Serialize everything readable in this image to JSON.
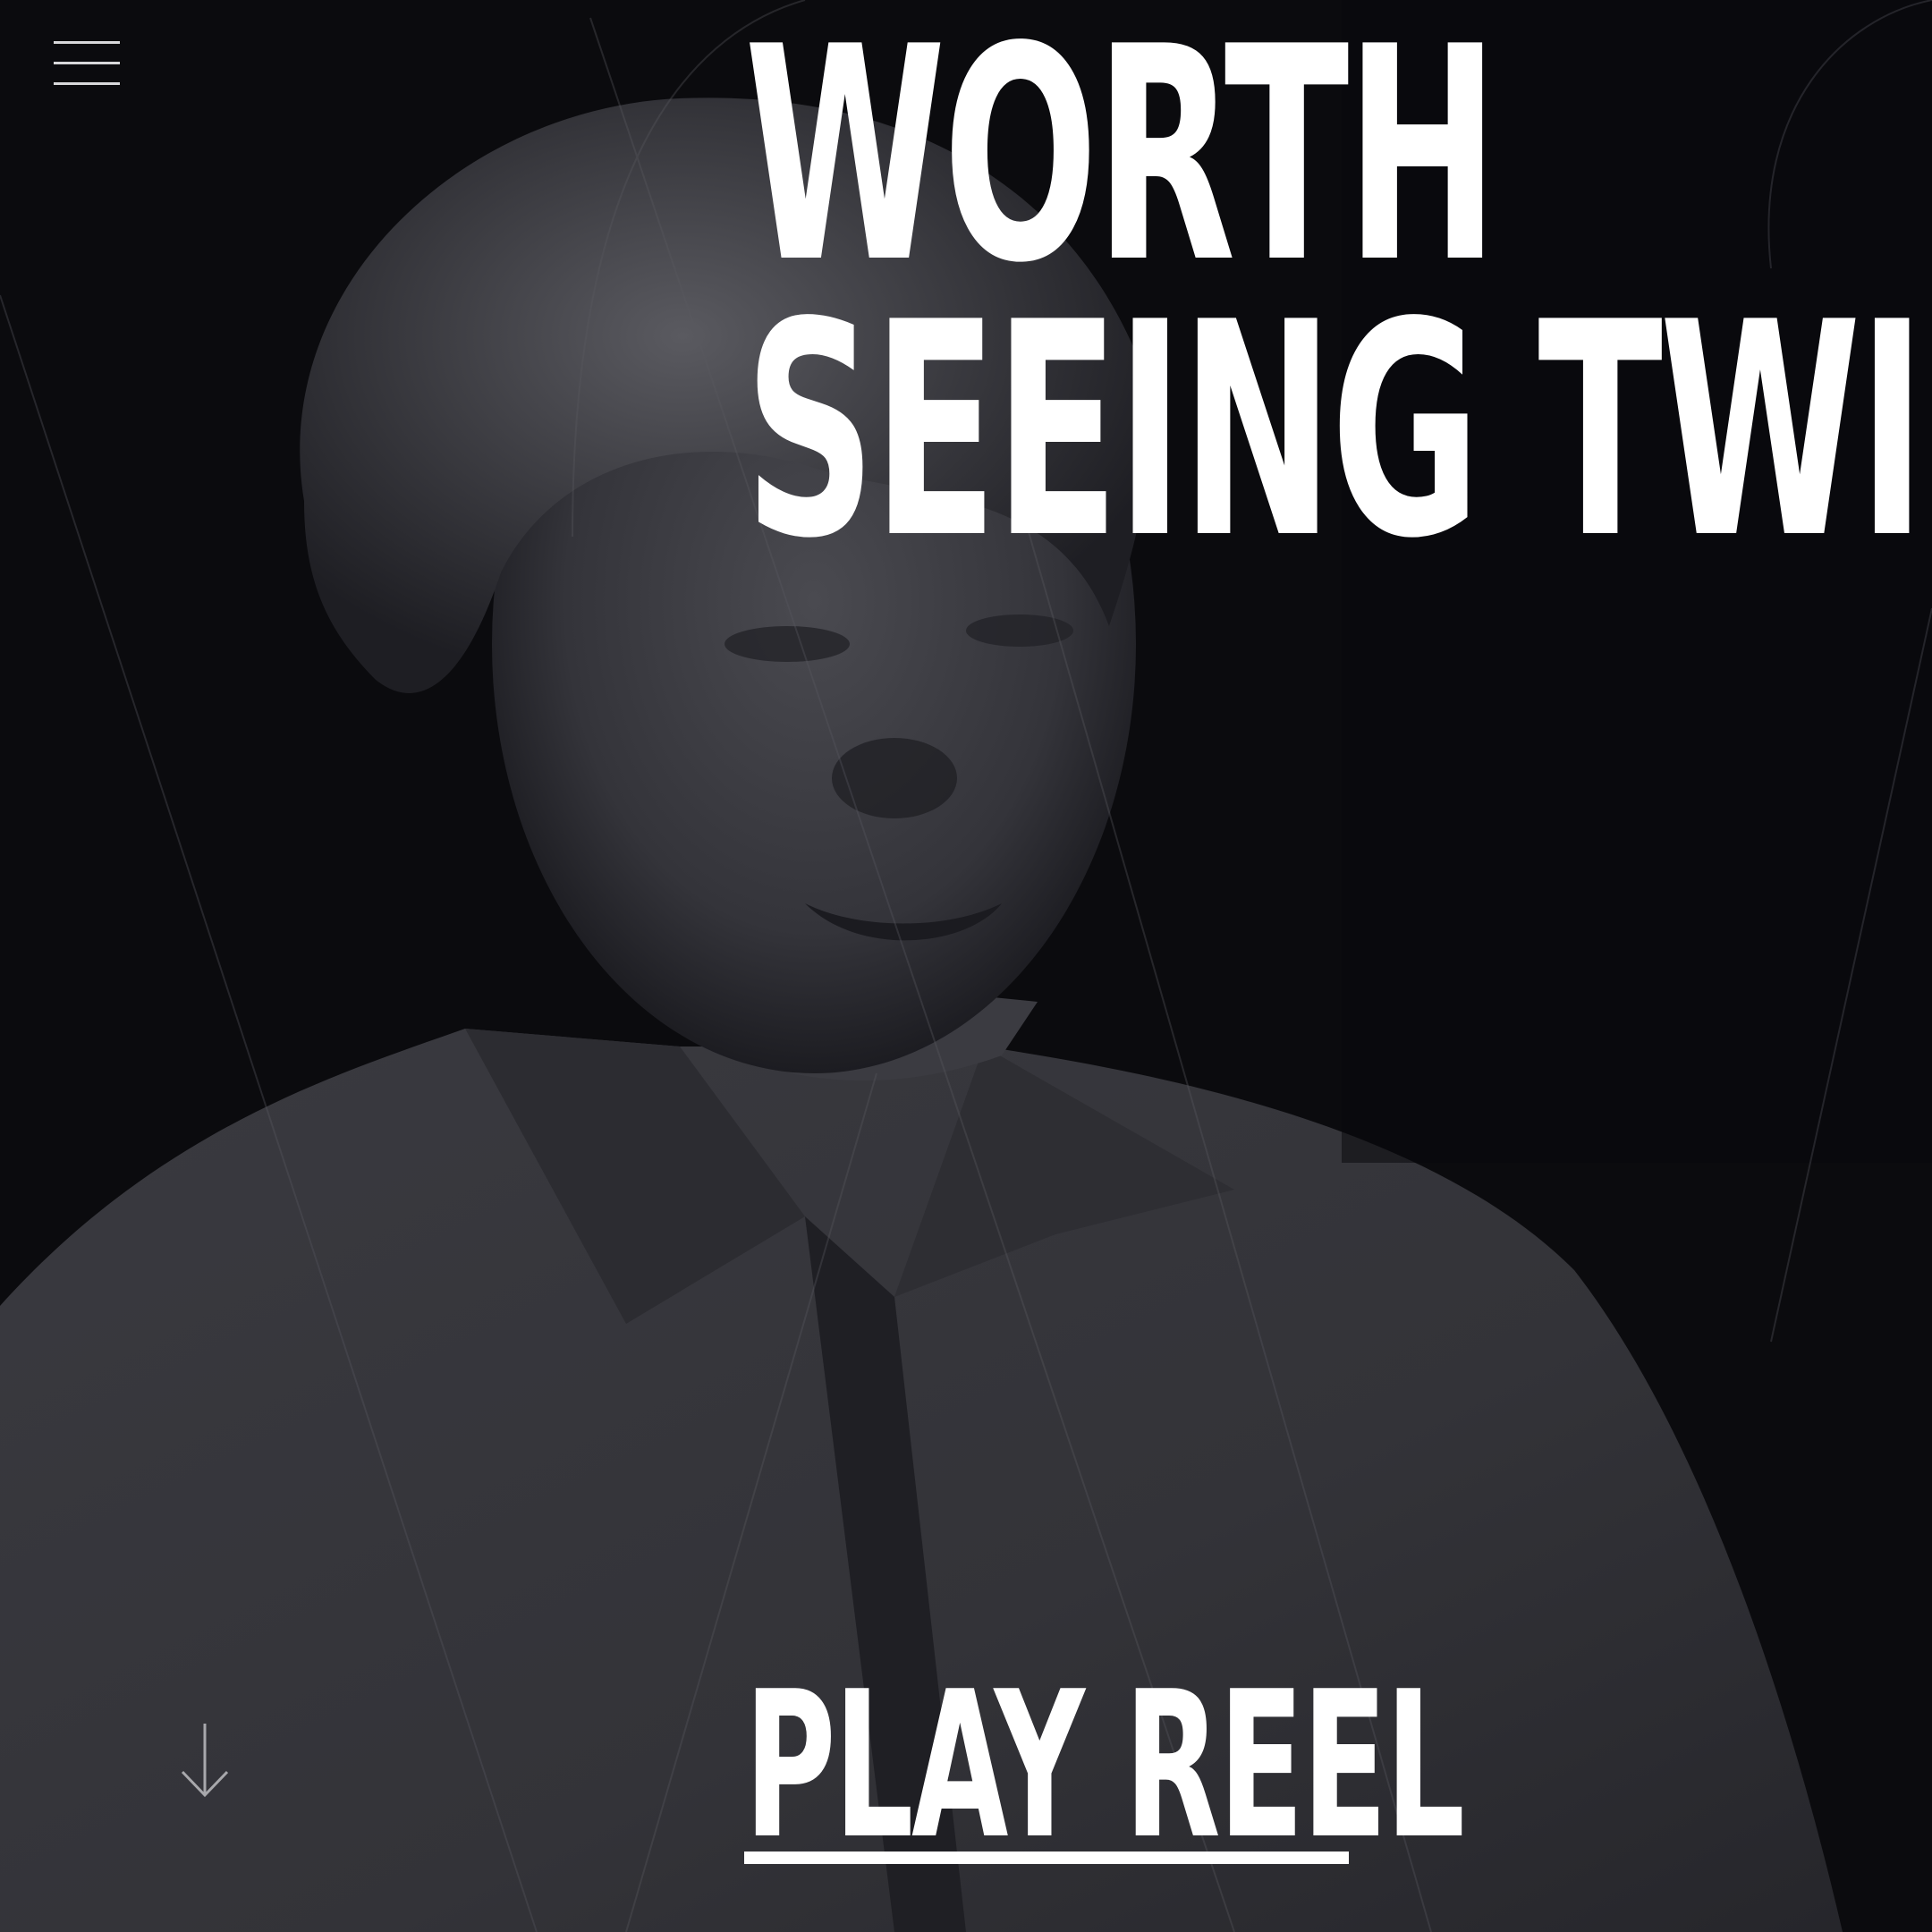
{
  "nav": {
    "menu_icon": "hamburger-menu-icon"
  },
  "hero": {
    "headline_line1": "WORTH",
    "headline_line2": "SEEING TWI",
    "background": "grayscale-portrait-photo",
    "cta_label": "PLAY REEL",
    "scroll_icon": "arrow-down-icon"
  },
  "colors": {
    "background": "#0b0b0e",
    "text": "#ffffff",
    "photo_tone": "#3a3a3f"
  }
}
